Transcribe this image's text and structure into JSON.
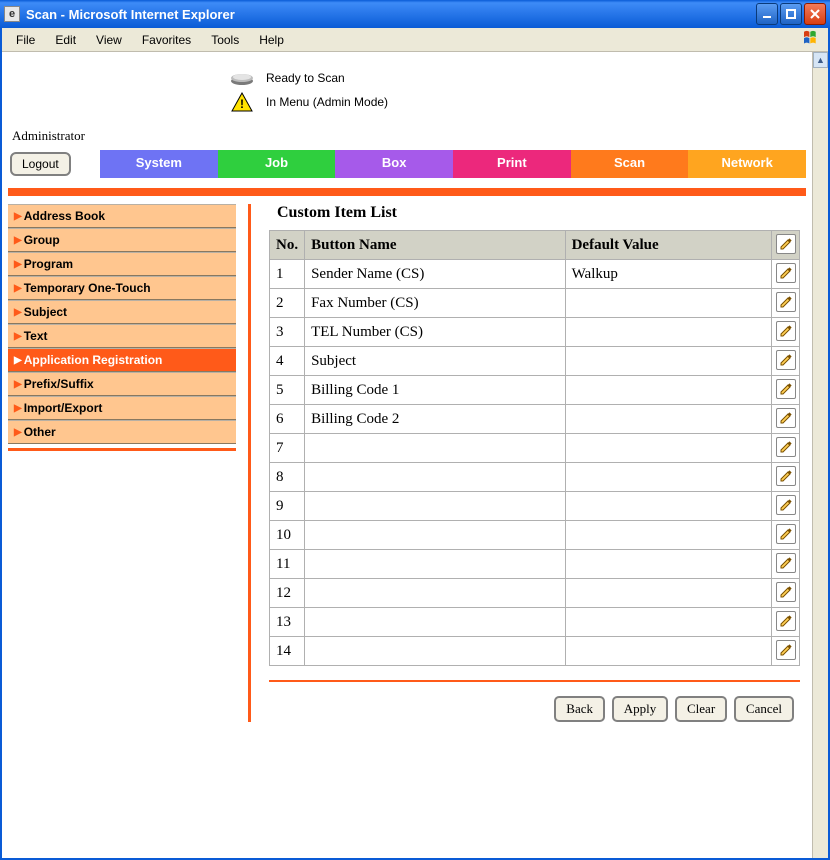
{
  "window": {
    "title": "Scan - Microsoft Internet Explorer"
  },
  "menubar": [
    "File",
    "Edit",
    "View",
    "Favorites",
    "Tools",
    "Help"
  ],
  "status": {
    "line1": "Ready to Scan",
    "line2": "In Menu (Admin Mode)"
  },
  "admin_label": "Administrator",
  "logout_label": "Logout",
  "tabs": {
    "system": "System",
    "job": "Job",
    "box": "Box",
    "print": "Print",
    "scan": "Scan",
    "network": "Network"
  },
  "sidebar": {
    "items": [
      {
        "label": "Address Book",
        "active": false
      },
      {
        "label": "Group",
        "active": false
      },
      {
        "label": "Program",
        "active": false
      },
      {
        "label": "Temporary One-Touch",
        "active": false
      },
      {
        "label": "Subject",
        "active": false
      },
      {
        "label": "Text",
        "active": false
      },
      {
        "label": "Application Registration",
        "active": true
      },
      {
        "label": "Prefix/Suffix",
        "active": false
      },
      {
        "label": "Import/Export",
        "active": false
      },
      {
        "label": "Other",
        "active": false
      }
    ]
  },
  "section_title": "Custom Item List",
  "columns": {
    "no": "No.",
    "name": "Button Name",
    "value": "Default Value"
  },
  "rows": [
    {
      "no": "1",
      "name": "Sender Name (CS)",
      "value": "Walkup"
    },
    {
      "no": "2",
      "name": "Fax Number (CS)",
      "value": ""
    },
    {
      "no": "3",
      "name": "TEL Number (CS)",
      "value": ""
    },
    {
      "no": "4",
      "name": "Subject",
      "value": ""
    },
    {
      "no": "5",
      "name": "Billing Code 1",
      "value": ""
    },
    {
      "no": "6",
      "name": "Billing Code 2",
      "value": ""
    },
    {
      "no": "7",
      "name": "",
      "value": ""
    },
    {
      "no": "8",
      "name": "",
      "value": ""
    },
    {
      "no": "9",
      "name": "",
      "value": ""
    },
    {
      "no": "10",
      "name": "",
      "value": ""
    },
    {
      "no": "11",
      "name": "",
      "value": ""
    },
    {
      "no": "12",
      "name": "",
      "value": ""
    },
    {
      "no": "13",
      "name": "",
      "value": ""
    },
    {
      "no": "14",
      "name": "",
      "value": ""
    }
  ],
  "buttons": {
    "back": "Back",
    "apply": "Apply",
    "clear": "Clear",
    "cancel": "Cancel"
  }
}
